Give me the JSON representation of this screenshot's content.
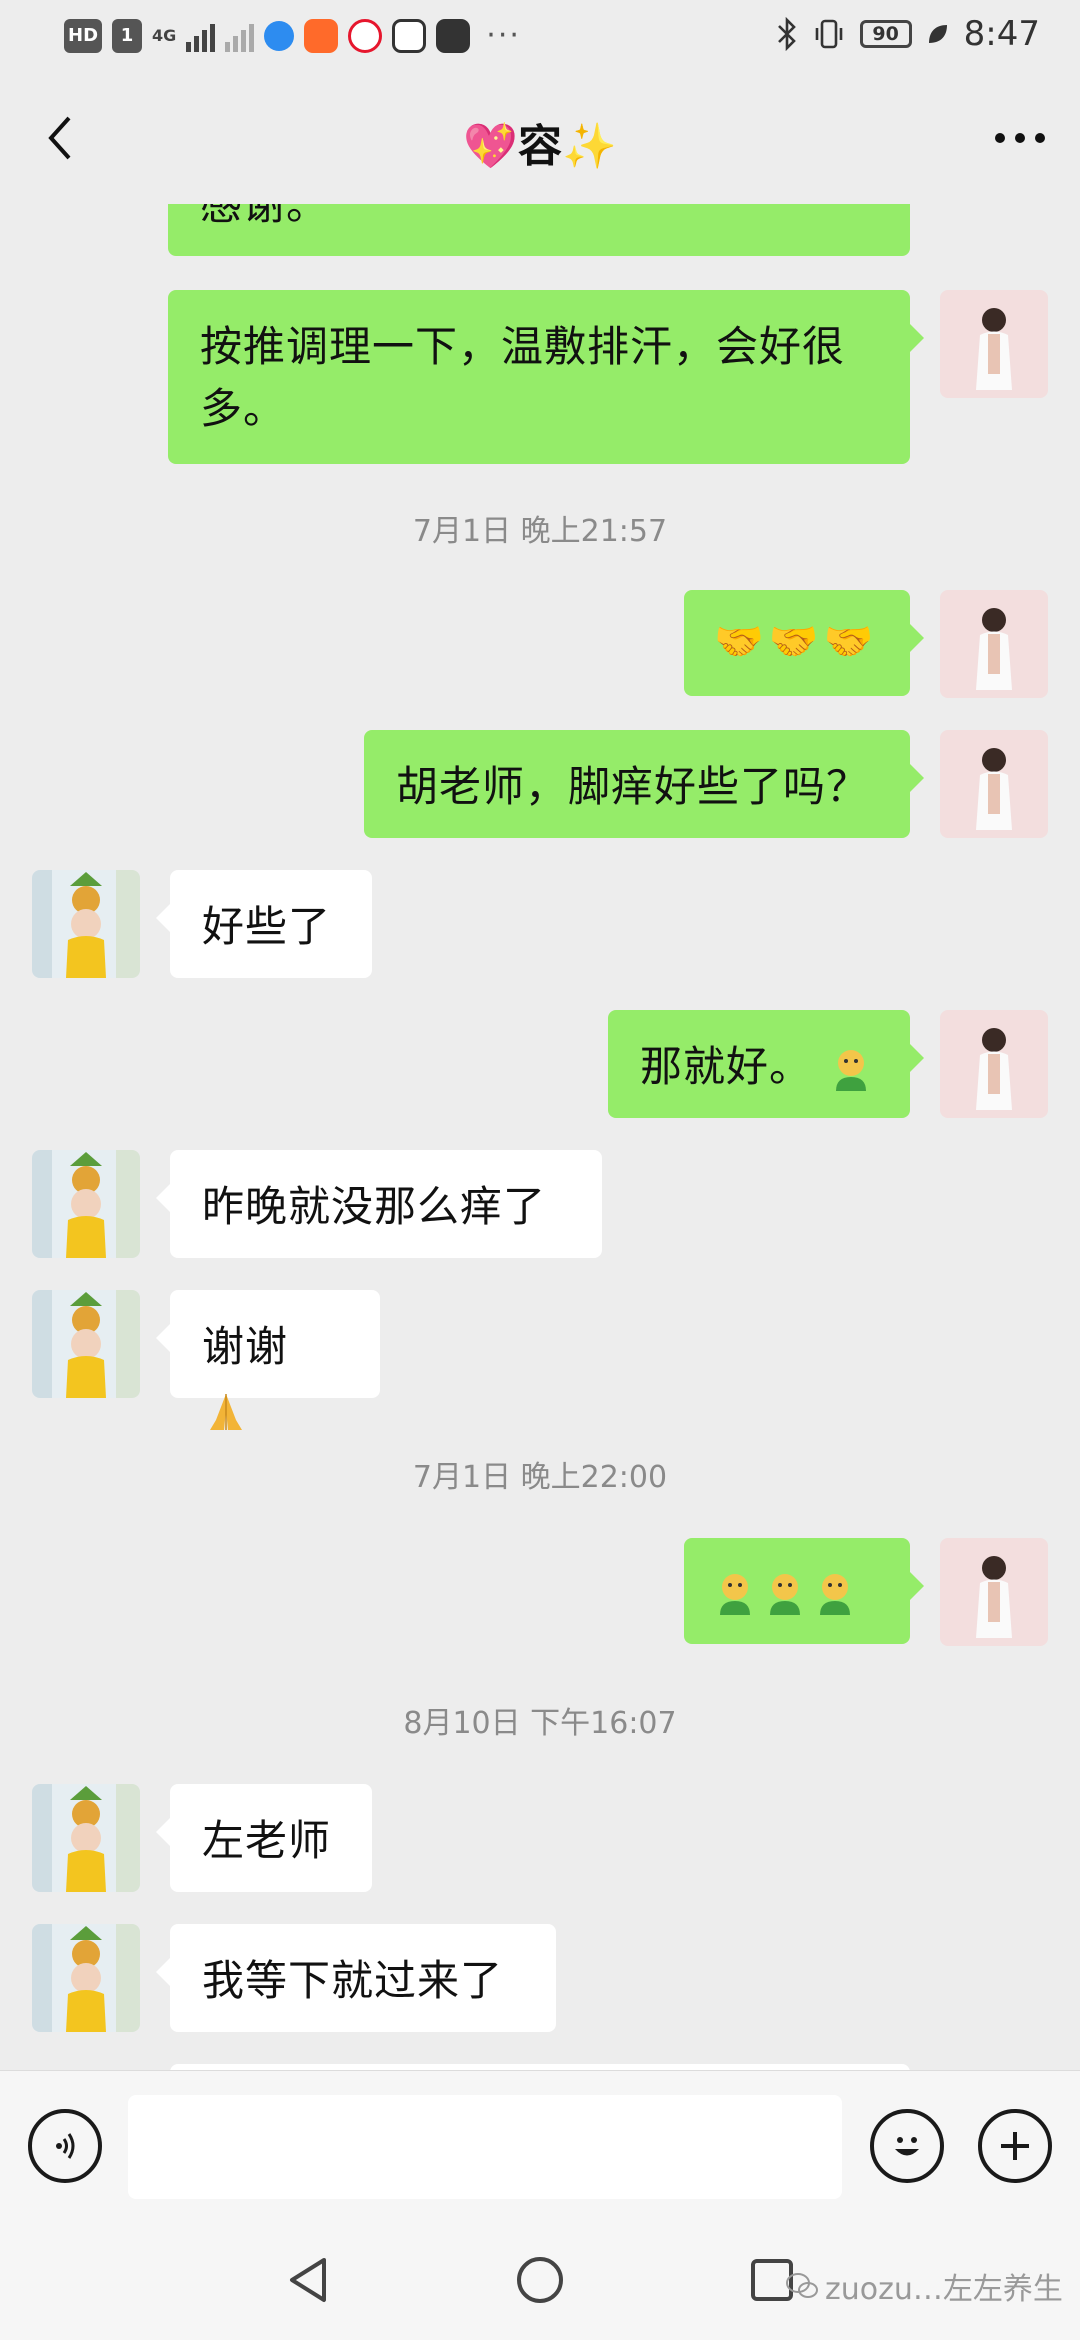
{
  "status_bar": {
    "hd_label": "HD",
    "sim_label": "1",
    "network_label": "4G",
    "battery": "90",
    "time": "8:47",
    "app_icons": [
      "store-badge-icon",
      "baby-app-icon",
      "weibo-icon",
      "shop-icon",
      "huawei-icon"
    ],
    "overflow": "···"
  },
  "header": {
    "title_prefix": "💖",
    "title": "容",
    "title_suffix": "✨",
    "back_icon": "chevron-left-icon",
    "more_icon": "ellipsis-icon"
  },
  "messages": [
    {
      "from": "me",
      "text": "感谢。",
      "partial": true
    },
    {
      "from": "me",
      "text": "按推调理一下，温敷排汗，会好很多。"
    },
    {
      "type": "timestamp",
      "text": "7月1日 晚上21:57"
    },
    {
      "from": "me",
      "emoji": [
        "handshake",
        "handshake",
        "handshake"
      ]
    },
    {
      "from": "me",
      "text": "胡老师，脚痒好些了吗？"
    },
    {
      "from": "them",
      "text": "好些了"
    },
    {
      "from": "me",
      "text": "那就好。",
      "emoji": [
        "green-face"
      ]
    },
    {
      "from": "them",
      "text": "昨晚就没那么痒了"
    },
    {
      "from": "them",
      "text": "谢谢",
      "emoji": [
        "pray"
      ]
    },
    {
      "type": "timestamp",
      "text": "7月1日 晚上22:00"
    },
    {
      "from": "me",
      "emoji": [
        "green-face",
        "green-face",
        "green-face"
      ]
    },
    {
      "type": "timestamp",
      "text": "8月10日 下午16:07"
    },
    {
      "from": "them",
      "text": "左老师"
    },
    {
      "from": "them",
      "text": "我等下就过来了"
    }
  ],
  "input_bar": {
    "placeholder": "",
    "voice_icon": "voice-icon",
    "emoji_icon": "emoji-icon",
    "plus_icon": "plus-icon"
  },
  "nav_bar": {
    "watermark": "zuozu…左左养生"
  },
  "colors": {
    "background": "#ededed",
    "my_bubble": "#95ec69",
    "their_bubble": "#ffffff",
    "timestamp": "#8a8a8a"
  }
}
